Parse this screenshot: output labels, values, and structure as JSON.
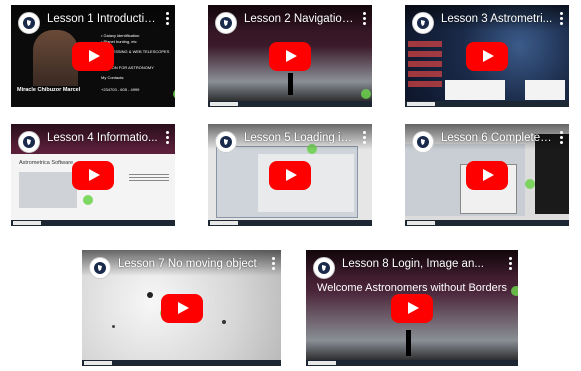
{
  "videos": [
    {
      "title": "Lesson 1 Introductio...",
      "play_label": "Play video"
    },
    {
      "title": "Lesson 2 Navigation...",
      "play_label": "Play video"
    },
    {
      "title": "Lesson 3 Astrometri...",
      "play_label": "Play video"
    },
    {
      "title": "Lesson 4 Informatio...",
      "play_label": "Play video"
    },
    {
      "title": "Lesson 5 Loading im...",
      "play_label": "Play video"
    },
    {
      "title": "Lesson 6 Complete i...",
      "play_label": "Play video"
    },
    {
      "title": "Lesson 7 No moving object",
      "play_label": "Play video"
    },
    {
      "title": "Lesson 8 Login, Image an...",
      "play_label": "Play video"
    }
  ],
  "lesson1": {
    "name": "Miracle Chibuzor Marcel",
    "items": [
      "• Galaxy identification",
      "• Planet hunting, etc",
      "PROCESSING & WEB TELESCOPES",
      "PYTHON FOR ASTRONOMY",
      "My Contacts:",
      "+234703 - 605 - 4999"
    ]
  },
  "lesson4": {
    "heading": "Astrometrica Software"
  },
  "lesson8": {
    "welcome": "Welcome Astronomers without Borders"
  },
  "colors": {
    "play_red": "#ff0000",
    "accent_green": "#6bd14a"
  }
}
